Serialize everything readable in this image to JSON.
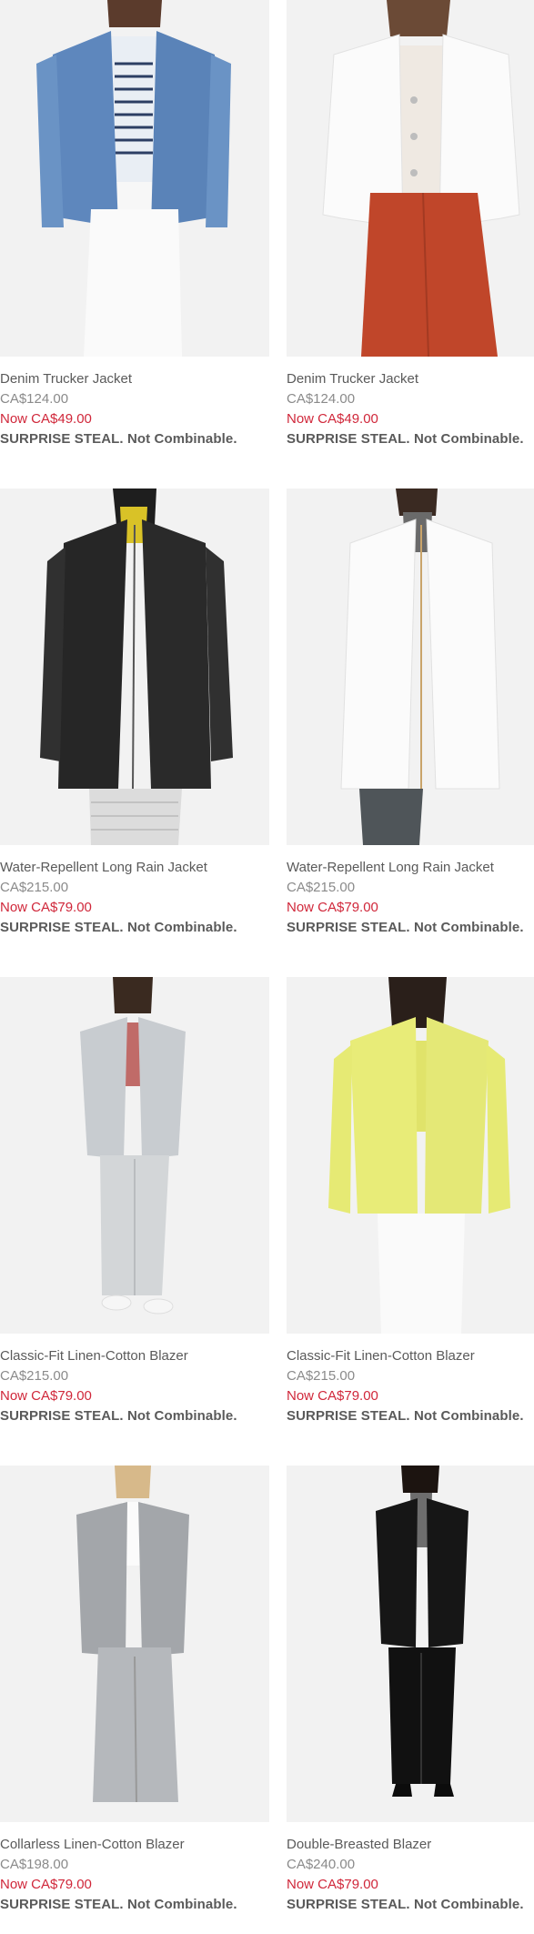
{
  "products": [
    {
      "name": "Denim Trucker Jacket",
      "original_price": "CA$124.00",
      "sale_price": "Now CA$49.00",
      "promo": "SURPRISE STEAL. Not Combinable.",
      "image_desc": "denim-jacket-blue"
    },
    {
      "name": "Denim Trucker Jacket",
      "original_price": "CA$124.00",
      "sale_price": "Now CA$49.00",
      "promo": "SURPRISE STEAL. Not Combinable.",
      "image_desc": "denim-jacket-white"
    },
    {
      "name": "Water-Repellent Long Rain Jacket",
      "original_price": "CA$215.00",
      "sale_price": "Now CA$79.00",
      "promo": "SURPRISE STEAL. Not Combinable.",
      "image_desc": "rain-jacket-black"
    },
    {
      "name": "Water-Repellent Long Rain Jacket",
      "original_price": "CA$215.00",
      "sale_price": "Now CA$79.00",
      "promo": "SURPRISE STEAL. Not Combinable.",
      "image_desc": "rain-jacket-white"
    },
    {
      "name": "Classic-Fit Linen-Cotton Blazer",
      "original_price": "CA$215.00",
      "sale_price": "Now CA$79.00",
      "promo": "SURPRISE STEAL. Not Combinable.",
      "image_desc": "blazer-gray"
    },
    {
      "name": "Classic-Fit Linen-Cotton Blazer",
      "original_price": "CA$215.00",
      "sale_price": "Now CA$79.00",
      "promo": "SURPRISE STEAL. Not Combinable.",
      "image_desc": "blazer-yellow"
    },
    {
      "name": "Collarless Linen-Cotton Blazer",
      "original_price": "CA$198.00",
      "sale_price": "Now CA$79.00",
      "promo": "SURPRISE STEAL. Not Combinable.",
      "image_desc": "collarless-blazer-gray"
    },
    {
      "name": "Double-Breasted Blazer",
      "original_price": "CA$240.00",
      "sale_price": "Now CA$79.00",
      "promo": "SURPRISE STEAL. Not Combinable.",
      "image_desc": "double-breasted-blazer-black"
    }
  ],
  "colors": {
    "sale": "#d0273a",
    "text": "#5a5a5a",
    "muted": "#8a8a8a",
    "photo_bg": "#f1f1f1"
  }
}
